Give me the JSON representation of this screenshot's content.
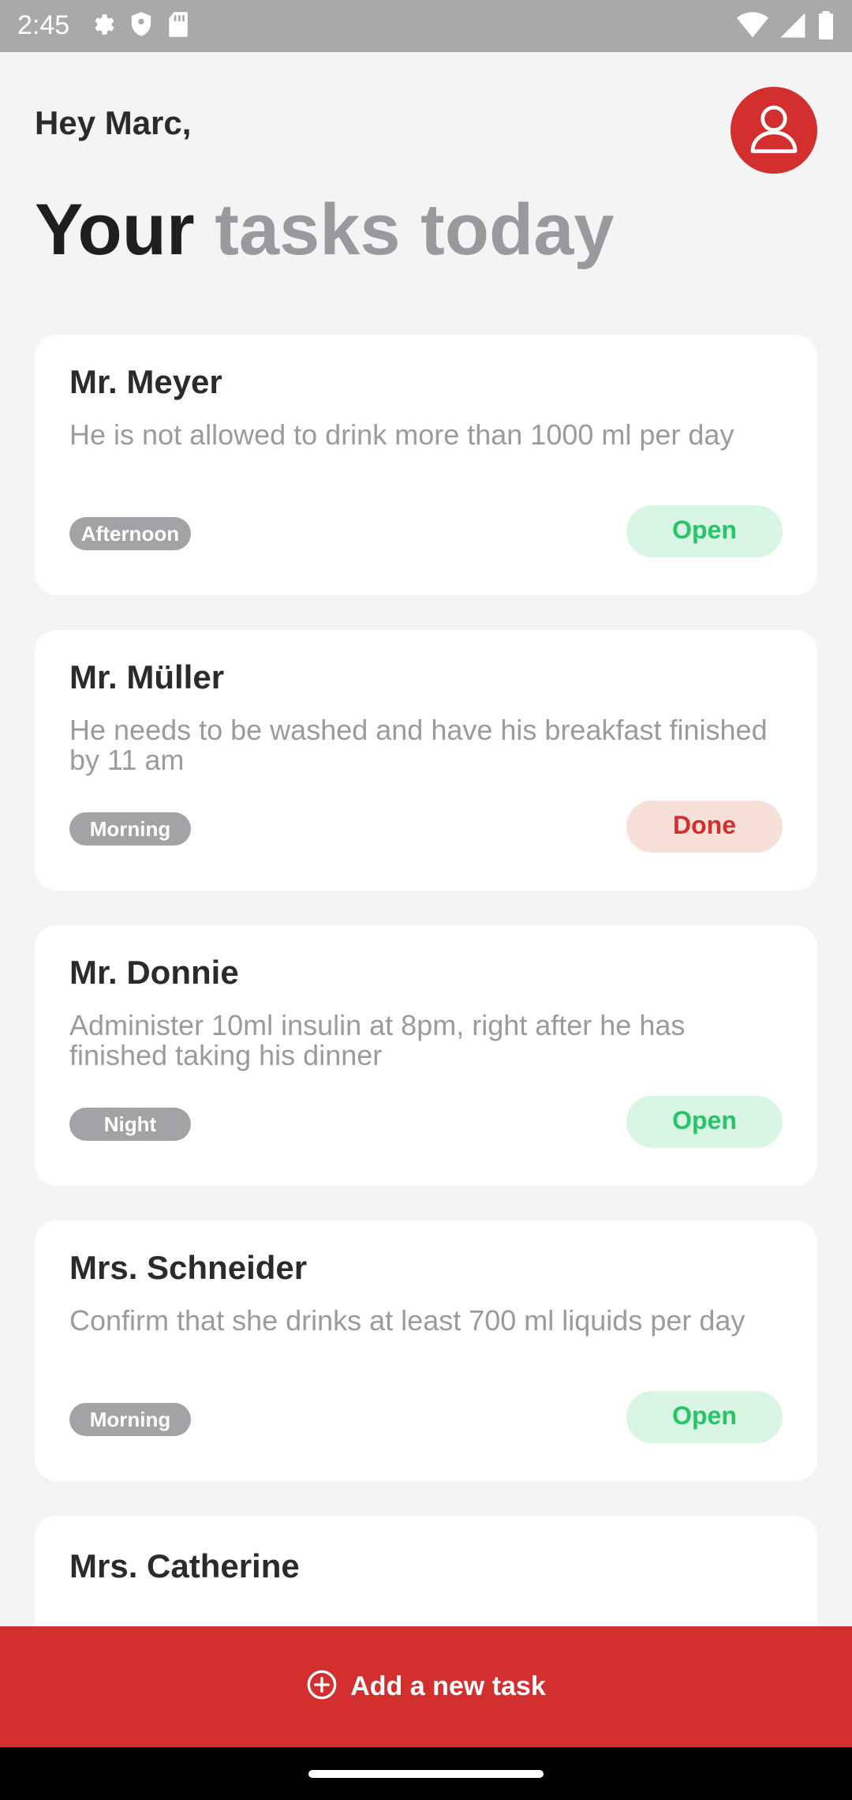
{
  "status_bar": {
    "time": "2:45",
    "left_icons": [
      "settings-icon",
      "shield-icon",
      "sd-card-icon"
    ],
    "right_icons": [
      "wifi-icon",
      "signal-icon",
      "battery-icon"
    ]
  },
  "header": {
    "greeting": "Hey Marc,",
    "title_strong": "Your",
    "title_muted": "tasks today",
    "avatar_icon": "user-icon"
  },
  "colors": {
    "accent": "#d32f2f",
    "open_bg": "#d9f5e4",
    "open_text": "#27c46a",
    "done_bg": "#f6e0d8",
    "chip_bg": "#a3a3a6"
  },
  "tasks": [
    {
      "name": "Mr. Meyer",
      "description": "He is not allowed to drink more than 1000 ml per day",
      "time": "Afternoon",
      "status": "Open"
    },
    {
      "name": "Mr. Müller",
      "description": "He needs to be washed and have his breakfast finished by 11 am",
      "time": "Morning",
      "status": "Done"
    },
    {
      "name": "Mr. Donnie",
      "description": "Administer 10ml insulin at 8pm, right after he has finished taking his dinner",
      "time": "Night",
      "status": "Open"
    },
    {
      "name": "Mrs. Schneider",
      "description": "Confirm that she drinks at least 700 ml liquids per day",
      "time": "Morning",
      "status": "Open"
    },
    {
      "name": "Mrs. Catherine",
      "description": "",
      "time": "",
      "status": ""
    }
  ],
  "add_task": {
    "label": "Add a new task",
    "icon": "plus-circle-icon"
  }
}
